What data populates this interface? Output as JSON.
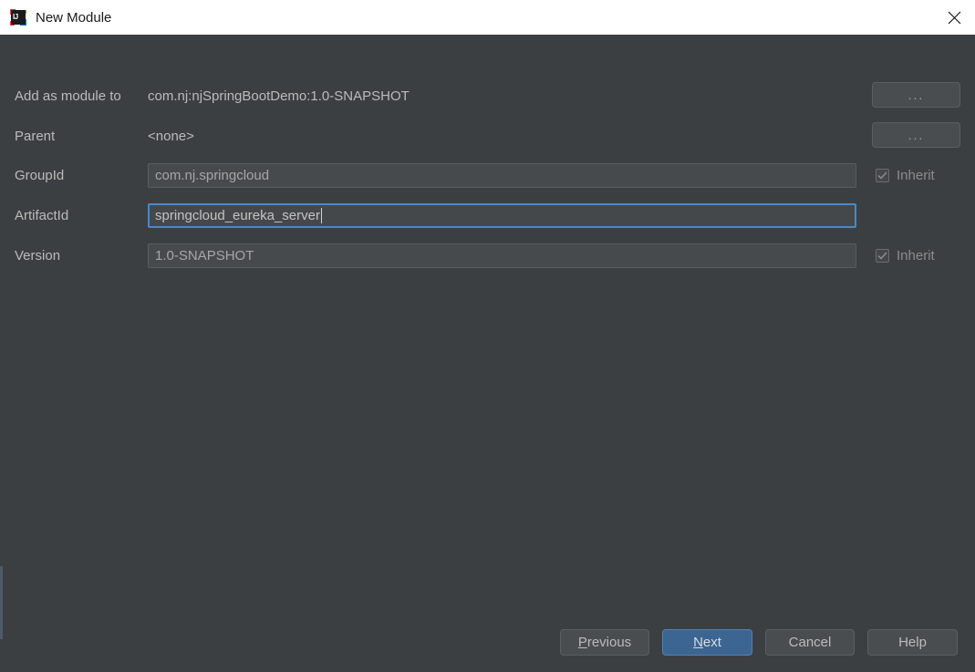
{
  "window": {
    "title": "New Module",
    "app_icon": "intellij-idea-icon",
    "icon_text": "IJ",
    "close_icon": "close-icon"
  },
  "form": {
    "rows": [
      {
        "label": "Add as module to",
        "type": "static",
        "value": "com.nj:njSpringBootDemo:1.0-SNAPSHOT",
        "browse_label": "...",
        "has_browse": true,
        "has_inherit": false
      },
      {
        "label": "Parent",
        "type": "static",
        "value": "<none>",
        "browse_label": "...",
        "has_browse": true,
        "has_inherit": false
      },
      {
        "label": "GroupId",
        "type": "input",
        "value": "com.nj.springcloud",
        "focused": false,
        "has_browse": false,
        "has_inherit": true,
        "inherit_label": "Inherit",
        "inherit_checked": true
      },
      {
        "label": "ArtifactId",
        "type": "input",
        "value": "springcloud_eureka_server",
        "focused": true,
        "has_browse": false,
        "has_inherit": false
      },
      {
        "label": "Version",
        "type": "input",
        "value": "1.0-SNAPSHOT",
        "focused": false,
        "has_browse": false,
        "has_inherit": true,
        "inherit_label": "Inherit",
        "inherit_checked": true
      }
    ]
  },
  "footer": {
    "buttons": [
      {
        "label": "Previous",
        "mnemonic": "P",
        "default": false
      },
      {
        "label": "Next",
        "mnemonic": "N",
        "default": true
      },
      {
        "label": "Cancel",
        "mnemonic": "",
        "default": false
      },
      {
        "label": "Help",
        "mnemonic": "",
        "default": false
      }
    ]
  },
  "colors": {
    "dialog_background": "#3c3f41",
    "titlebar_background": "#ffffff",
    "field_background": "#474a4c",
    "focus_border": "#4a88c7",
    "default_button": "#3c6591",
    "text": "#bbbbbb",
    "disabled_text": "#8c8c8c"
  }
}
